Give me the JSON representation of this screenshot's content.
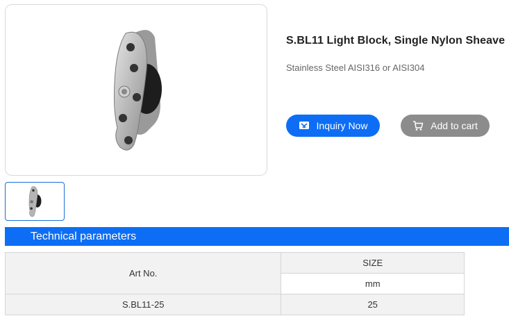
{
  "product": {
    "title": "S.BL11 Light Block, Single Nylon Sheave",
    "material": "Stainless Steel AISI316 or AISI304",
    "image_icon": "pulley-block-image"
  },
  "actions": {
    "inquiry_label": "Inquiry Now",
    "inquiry_icon": "message-icon",
    "cart_label": "Add to cart",
    "cart_icon": "cart-icon"
  },
  "section": {
    "title": "Technical parameters"
  },
  "table": {
    "col1_header": "Art No.",
    "col2_header": "SIZE",
    "col2_unit": "mm",
    "rows": [
      {
        "art_no": "S.BL11-25",
        "size": "25"
      }
    ]
  },
  "colors": {
    "accent": "#0d6ef5",
    "cart_button": "#8c8c8c"
  }
}
